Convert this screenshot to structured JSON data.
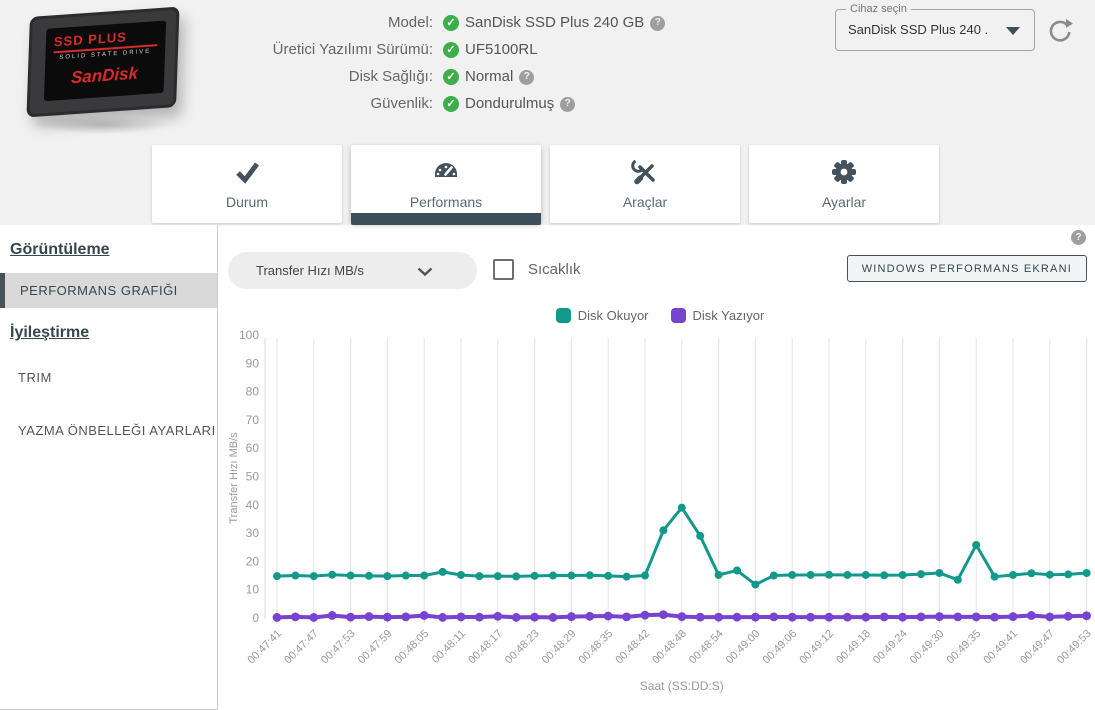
{
  "header": {
    "rows": [
      {
        "label": "Model:",
        "value": "SanDisk SSD Plus 240 GB",
        "help": true
      },
      {
        "label": "Üretici Yazılımı Sürümü:",
        "value": "UF5100RL",
        "help": false
      },
      {
        "label": "Disk Sağlığı:",
        "value": "Normal",
        "help": true
      },
      {
        "label": "Güvenlik:",
        "value": "Dondurulmuş",
        "help": true
      }
    ],
    "check_glyph": "✓",
    "help_glyph": "?",
    "device_select": {
      "legend": "Cihaz seçin",
      "value": "SanDisk SSD Plus 240 ..."
    },
    "ssd_image": {
      "line1": "SSD PLUS",
      "line2": "SOLID STATE DRIVE",
      "brand": "SanDisk"
    }
  },
  "tabs": [
    {
      "label": "Durum",
      "icon": "check-icon",
      "active": false
    },
    {
      "label": "Performans",
      "icon": "gauge-icon",
      "active": true
    },
    {
      "label": "Araçlar",
      "icon": "tools-icon",
      "active": false
    },
    {
      "label": "Ayarlar",
      "icon": "gear-icon",
      "active": false
    }
  ],
  "sidebar": {
    "sections": [
      {
        "heading": "Görüntüleme",
        "items": [
          {
            "label": "PERFORMANS GRAFIĞI",
            "selected": true
          }
        ]
      },
      {
        "heading": "İyileştirme",
        "items": [
          {
            "label": "TRIM",
            "selected": false
          },
          {
            "label": "YAZMA ÖNBELLEĞI AYARLARI",
            "selected": false
          }
        ]
      }
    ]
  },
  "controls": {
    "metric_dropdown_value": "Transfer Hızı MB/s",
    "temperature_checkbox": {
      "label": "Sıcaklık",
      "checked": false
    },
    "windows_perf_button": "WINDOWS PERFORMANS EKRANI"
  },
  "colors": {
    "read_teal": "#12998c",
    "write_purple": "#7743d1",
    "status_green": "#3cae4a",
    "slate": "#44535b",
    "header_bg": "#f1f1f1"
  },
  "chart_data": {
    "type": "line",
    "xlabel": "Saat (SS:DD:S)",
    "ylabel": "Transfer Hızı MB/s",
    "ylim": [
      0,
      100
    ],
    "ytick_step": 10,
    "grid": "vertical",
    "legend_position": "top-center",
    "x_labels": [
      "00:47:41",
      "00:47:47",
      "00:47:53",
      "00:47:59",
      "00:48:05",
      "00:48:11",
      "00:48:17",
      "00:48:23",
      "00:48:29",
      "00:48:35",
      "00:48:42",
      "00:48:48",
      "00:48:54",
      "00:49:00",
      "00:49:06",
      "00:49:12",
      "00:49:18",
      "00:49:24",
      "00:49:30",
      "00:49:35",
      "00:49:41",
      "00:49:47",
      "00:49:53"
    ],
    "points_per_label_interval": 2,
    "series": [
      {
        "name": "Disk Okuyor",
        "color": "#12998c",
        "values": [
          14.8,
          15.0,
          14.8,
          15.3,
          15.0,
          14.9,
          14.8,
          15.0,
          15.0,
          16.3,
          15.2,
          14.8,
          14.8,
          14.7,
          14.9,
          15.0,
          15.0,
          15.1,
          14.9,
          14.6,
          15.0,
          31.0,
          39.0,
          29.0,
          15.2,
          16.8,
          11.8,
          15.0,
          15.2,
          15.2,
          15.3,
          15.2,
          15.2,
          15.1,
          15.2,
          15.5,
          15.9,
          13.5,
          25.8,
          14.6,
          15.2,
          15.8,
          15.3,
          15.4,
          15.9
        ]
      },
      {
        "name": "Disk Yazıyor",
        "color": "#7743d1",
        "values": [
          0.2,
          0.4,
          0.2,
          0.9,
          0.3,
          0.5,
          0.3,
          0.4,
          0.9,
          0.2,
          0.4,
          0.3,
          0.6,
          0.2,
          0.3,
          0.2,
          0.5,
          0.6,
          0.7,
          0.4,
          1.0,
          1.2,
          0.5,
          0.3,
          0.3,
          0.3,
          0.3,
          0.4,
          0.3,
          0.3,
          0.3,
          0.3,
          0.3,
          0.4,
          0.3,
          0.4,
          0.5,
          0.4,
          0.4,
          0.3,
          0.5,
          0.9,
          0.4,
          0.6,
          0.8
        ]
      }
    ]
  }
}
